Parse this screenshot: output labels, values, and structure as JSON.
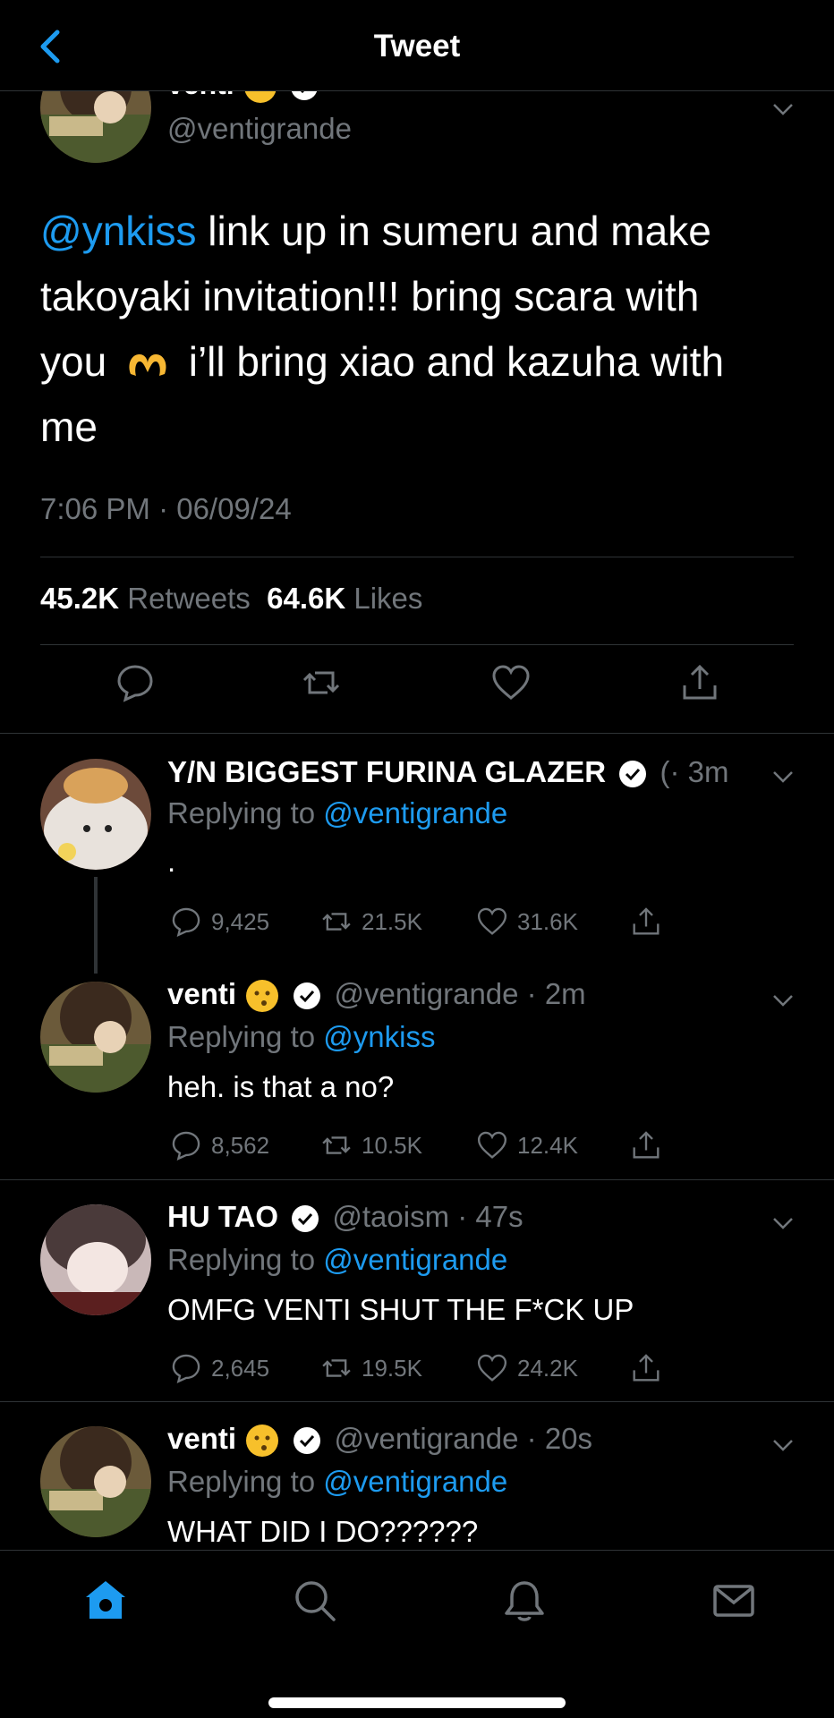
{
  "header": {
    "title": "Tweet"
  },
  "main_tweet": {
    "name": "venti",
    "handle": "@ventigrande",
    "text_mention": "@ynkiss",
    "text_line1": " link up in sumeru and make",
    "text_line2": "takoyaki invitation!!! bring scara with",
    "text_line3a": "you",
    "text_line3b": " i’ll bring xiao and kazuha with",
    "text_line4": "me",
    "timestamp": "7:06 PM · 06/09/24",
    "retweets_count": "45.2K",
    "retweets_label": "Retweets",
    "likes_count": "64.6K",
    "likes_label": "Likes"
  },
  "replies": [
    {
      "name": "Y/N BIGGEST FURINA GLAZER",
      "handle_time": "(· 3m",
      "replying_label": "Replying to",
      "replying_to": "@ventigrande",
      "text": ".",
      "replies": "9,425",
      "retweets": "21.5K",
      "likes": "31.6K"
    },
    {
      "name": "venti",
      "handle_time": "@ventigrande · 2m",
      "replying_label": "Replying to",
      "replying_to": "@ynkiss",
      "text": "heh. is that a no?",
      "replies": "8,562",
      "retweets": "10.5K",
      "likes": "12.4K"
    },
    {
      "name": "HU TAO",
      "handle_time": "@taoism · 47s",
      "replying_label": "Replying to",
      "replying_to": "@ventigrande",
      "text": "OMFG VENTI SHUT THE F*CK UP",
      "replies": "2,645",
      "retweets": "19.5K",
      "likes": "24.2K"
    },
    {
      "name": "venti",
      "handle_time": "@ventigrande · 20s",
      "replying_label": "Replying to",
      "replying_to": "@ventigrande",
      "text": "WHAT DID I DO??????"
    }
  ],
  "colors": {
    "accent": "#1d9bf0",
    "muted": "#71767b",
    "divider": "#2f3336",
    "background": "#000000"
  },
  "icons": {
    "header": "back-chevron-icon",
    "bottom_nav": [
      "home-icon",
      "search-icon",
      "notifications-bell-icon",
      "messages-envelope-icon"
    ]
  }
}
